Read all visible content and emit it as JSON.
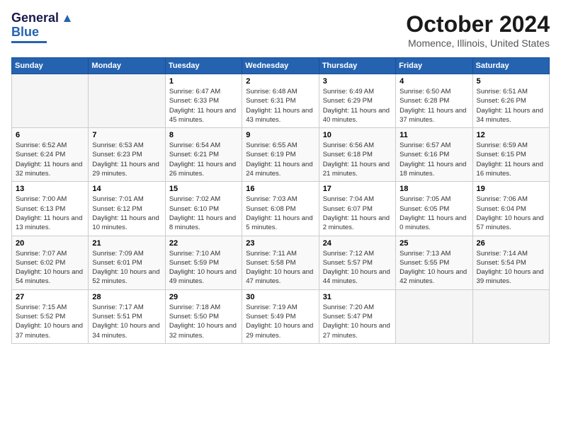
{
  "logo": {
    "line1": "General",
    "line2": "Blue"
  },
  "title": "October 2024",
  "location": "Momence, Illinois, United States",
  "days_of_week": [
    "Sunday",
    "Monday",
    "Tuesday",
    "Wednesday",
    "Thursday",
    "Friday",
    "Saturday"
  ],
  "weeks": [
    [
      {
        "day": "",
        "info": ""
      },
      {
        "day": "",
        "info": ""
      },
      {
        "day": "1",
        "info": "Sunrise: 6:47 AM\nSunset: 6:33 PM\nDaylight: 11 hours and 45 minutes."
      },
      {
        "day": "2",
        "info": "Sunrise: 6:48 AM\nSunset: 6:31 PM\nDaylight: 11 hours and 43 minutes."
      },
      {
        "day": "3",
        "info": "Sunrise: 6:49 AM\nSunset: 6:29 PM\nDaylight: 11 hours and 40 minutes."
      },
      {
        "day": "4",
        "info": "Sunrise: 6:50 AM\nSunset: 6:28 PM\nDaylight: 11 hours and 37 minutes."
      },
      {
        "day": "5",
        "info": "Sunrise: 6:51 AM\nSunset: 6:26 PM\nDaylight: 11 hours and 34 minutes."
      }
    ],
    [
      {
        "day": "6",
        "info": "Sunrise: 6:52 AM\nSunset: 6:24 PM\nDaylight: 11 hours and 32 minutes."
      },
      {
        "day": "7",
        "info": "Sunrise: 6:53 AM\nSunset: 6:23 PM\nDaylight: 11 hours and 29 minutes."
      },
      {
        "day": "8",
        "info": "Sunrise: 6:54 AM\nSunset: 6:21 PM\nDaylight: 11 hours and 26 minutes."
      },
      {
        "day": "9",
        "info": "Sunrise: 6:55 AM\nSunset: 6:19 PM\nDaylight: 11 hours and 24 minutes."
      },
      {
        "day": "10",
        "info": "Sunrise: 6:56 AM\nSunset: 6:18 PM\nDaylight: 11 hours and 21 minutes."
      },
      {
        "day": "11",
        "info": "Sunrise: 6:57 AM\nSunset: 6:16 PM\nDaylight: 11 hours and 18 minutes."
      },
      {
        "day": "12",
        "info": "Sunrise: 6:59 AM\nSunset: 6:15 PM\nDaylight: 11 hours and 16 minutes."
      }
    ],
    [
      {
        "day": "13",
        "info": "Sunrise: 7:00 AM\nSunset: 6:13 PM\nDaylight: 11 hours and 13 minutes."
      },
      {
        "day": "14",
        "info": "Sunrise: 7:01 AM\nSunset: 6:12 PM\nDaylight: 11 hours and 10 minutes."
      },
      {
        "day": "15",
        "info": "Sunrise: 7:02 AM\nSunset: 6:10 PM\nDaylight: 11 hours and 8 minutes."
      },
      {
        "day": "16",
        "info": "Sunrise: 7:03 AM\nSunset: 6:08 PM\nDaylight: 11 hours and 5 minutes."
      },
      {
        "day": "17",
        "info": "Sunrise: 7:04 AM\nSunset: 6:07 PM\nDaylight: 11 hours and 2 minutes."
      },
      {
        "day": "18",
        "info": "Sunrise: 7:05 AM\nSunset: 6:05 PM\nDaylight: 11 hours and 0 minutes."
      },
      {
        "day": "19",
        "info": "Sunrise: 7:06 AM\nSunset: 6:04 PM\nDaylight: 10 hours and 57 minutes."
      }
    ],
    [
      {
        "day": "20",
        "info": "Sunrise: 7:07 AM\nSunset: 6:02 PM\nDaylight: 10 hours and 54 minutes."
      },
      {
        "day": "21",
        "info": "Sunrise: 7:09 AM\nSunset: 6:01 PM\nDaylight: 10 hours and 52 minutes."
      },
      {
        "day": "22",
        "info": "Sunrise: 7:10 AM\nSunset: 5:59 PM\nDaylight: 10 hours and 49 minutes."
      },
      {
        "day": "23",
        "info": "Sunrise: 7:11 AM\nSunset: 5:58 PM\nDaylight: 10 hours and 47 minutes."
      },
      {
        "day": "24",
        "info": "Sunrise: 7:12 AM\nSunset: 5:57 PM\nDaylight: 10 hours and 44 minutes."
      },
      {
        "day": "25",
        "info": "Sunrise: 7:13 AM\nSunset: 5:55 PM\nDaylight: 10 hours and 42 minutes."
      },
      {
        "day": "26",
        "info": "Sunrise: 7:14 AM\nSunset: 5:54 PM\nDaylight: 10 hours and 39 minutes."
      }
    ],
    [
      {
        "day": "27",
        "info": "Sunrise: 7:15 AM\nSunset: 5:52 PM\nDaylight: 10 hours and 37 minutes."
      },
      {
        "day": "28",
        "info": "Sunrise: 7:17 AM\nSunset: 5:51 PM\nDaylight: 10 hours and 34 minutes."
      },
      {
        "day": "29",
        "info": "Sunrise: 7:18 AM\nSunset: 5:50 PM\nDaylight: 10 hours and 32 minutes."
      },
      {
        "day": "30",
        "info": "Sunrise: 7:19 AM\nSunset: 5:49 PM\nDaylight: 10 hours and 29 minutes."
      },
      {
        "day": "31",
        "info": "Sunrise: 7:20 AM\nSunset: 5:47 PM\nDaylight: 10 hours and 27 minutes."
      },
      {
        "day": "",
        "info": ""
      },
      {
        "day": "",
        "info": ""
      }
    ]
  ]
}
